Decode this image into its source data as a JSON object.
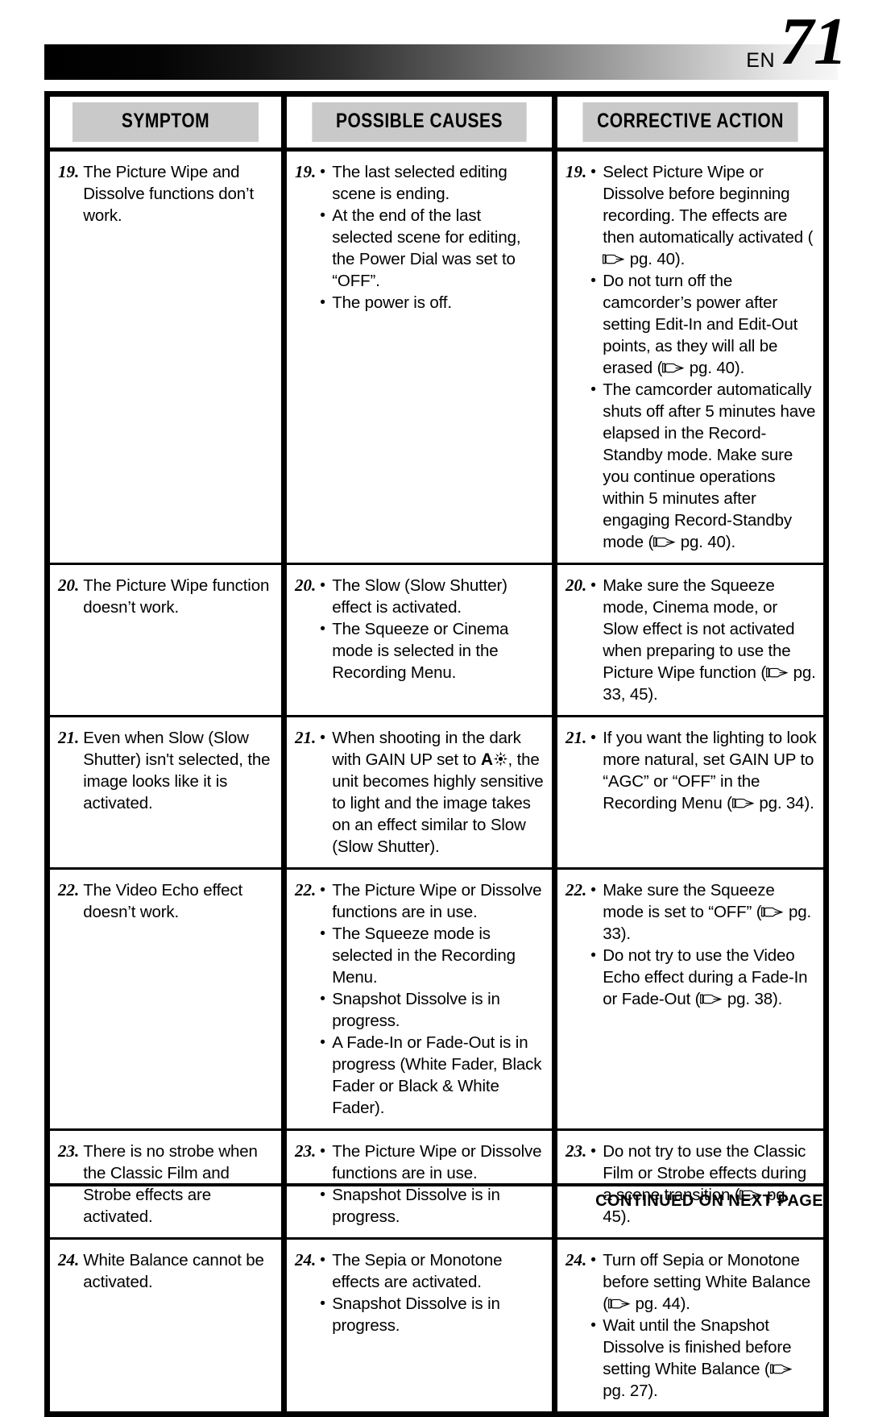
{
  "header": {
    "language_label": "EN",
    "page_number": "71",
    "gradient_from": "#000000",
    "gradient_to": "#f7f7f7"
  },
  "table": {
    "header_fill": "#c9c9c9",
    "columns": [
      {
        "label": "SYMPTOM"
      },
      {
        "label": "POSSIBLE CAUSES"
      },
      {
        "label": "CORRECTIVE ACTION"
      }
    ],
    "rows": [
      {
        "number": "19.",
        "symptom": "The Picture Wipe and Dissolve functions don’t work.",
        "causes": [
          "The last selected editing scene is ending.",
          "At the end of the last selected scene for editing, the Power Dial was set to “OFF”.",
          "The power is off."
        ],
        "actions": [
          "Select Picture Wipe or Dissolve before beginning recording. The effects are then automatically activated (☞ pg. 40).",
          "Do not turn off the camcorder’s power after setting Edit-In and Edit-Out points, as they will all be erased (☞ pg. 40).",
          "The camcorder automatically shuts off after 5 minutes have elapsed in the Record-Standby mode. Make sure you continue operations within 5 minutes after engaging Record-Standby mode (☞ pg. 40)."
        ]
      },
      {
        "number": "20.",
        "symptom": "The Picture Wipe function doesn’t work.",
        "causes": [
          "The Slow (Slow Shutter) effect is activated.",
          "The Squeeze or Cinema mode is selected in the Recording Menu."
        ],
        "actions": [
          "Make sure the Squeeze mode, Cinema mode, or Slow effect is not activated when preparing to use the Picture Wipe function (☞ pg. 33, 45)."
        ]
      },
      {
        "number": "21.",
        "symptom": "Even when Slow (Slow Shutter) isn't selected, the image looks like it is activated.",
        "causes": [
          "When shooting in the dark with GAIN UP set to [GAINUP-ICON], the unit becomes highly sensitive to light and the image takes on an effect similar to Slow (Slow Shutter)."
        ],
        "actions": [
          "If you want the lighting to look more natural, set GAIN UP to “AGC” or “OFF” in the Recording Menu (☞ pg. 34)."
        ]
      },
      {
        "number": "22.",
        "symptom": "The Video Echo effect doesn’t work.",
        "causes": [
          "The Picture Wipe or Dissolve functions are in use.",
          "The Squeeze mode is selected in the Recording Menu.",
          "Snapshot Dissolve is in progress.",
          "A Fade-In or Fade-Out is in progress (White Fader, Black Fader or Black & White Fader)."
        ],
        "actions": [
          "Make sure the Squeeze mode is set to “OFF” (☞ pg. 33).",
          "Do not try to use the Video Echo effect during a Fade-In or Fade-Out (☞ pg. 38)."
        ]
      },
      {
        "number": "23.",
        "symptom": "There is no strobe when the Classic Film and Strobe effects are activated.",
        "causes": [
          "The Picture Wipe or Dissolve functions are in use.",
          "Snapshot Dissolve is in progress."
        ],
        "actions": [
          "Do not try to use the Classic Film or Strobe effects during a scene transition (☞ pg. 45)."
        ]
      },
      {
        "number": "24.",
        "symptom": "White Balance cannot be activated.",
        "causes": [
          "The Sepia or Monotone effects are activated.",
          "Snapshot Dissolve is in progress."
        ],
        "actions": [
          "Turn off Sepia or Monotone before setting White Balance (☞ pg. 44).",
          "Wait until the Snapshot Dissolve is finished before setting White Balance (☞ pg. 27)."
        ]
      }
    ]
  },
  "footer": {
    "note": "CONTINUED ON NEXT PAGE"
  },
  "icons": {
    "see_page_hand": "pointing-hand-icon",
    "gain_up_auto": "gain-up-auto-icon"
  }
}
